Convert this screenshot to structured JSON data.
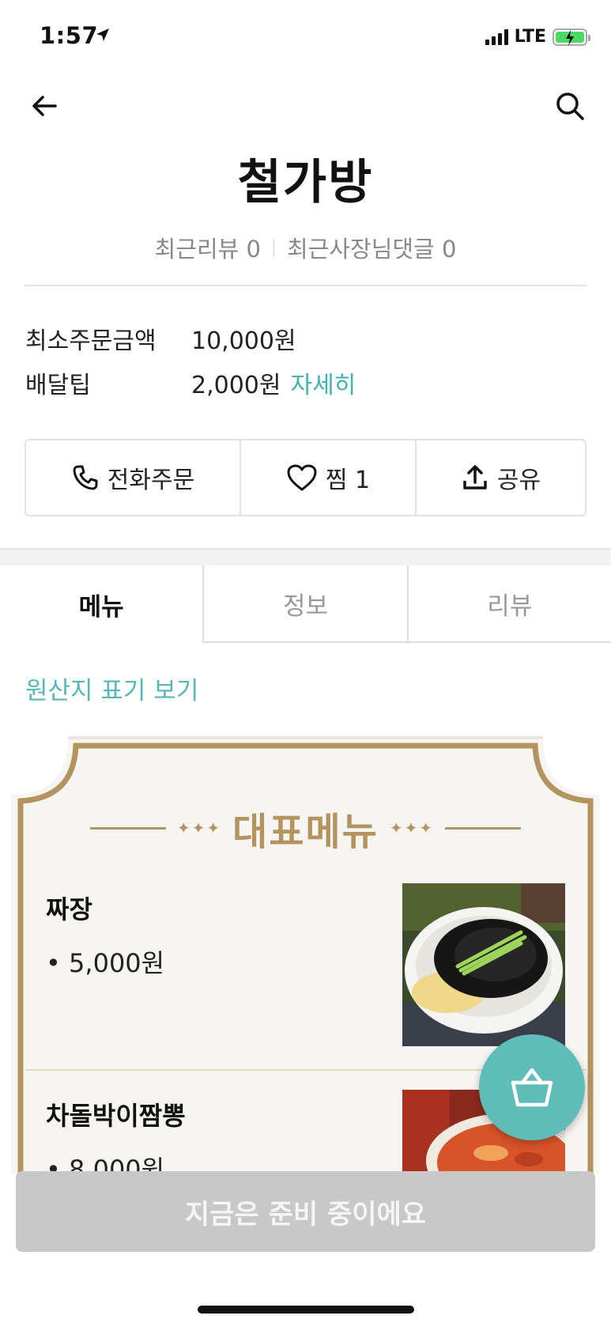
{
  "status_bar": {
    "time": "1:57",
    "network": "LTE"
  },
  "store": {
    "title": "철가방",
    "recent_reviews": "최근리뷰 0",
    "recent_owner_comments": "최근사장님댓글 0"
  },
  "info": {
    "min_order_label": "최소주문금액",
    "min_order_value": "10,000원",
    "delivery_tip_label": "배달팁",
    "delivery_tip_value": "2,000원",
    "delivery_tip_link": "자세히"
  },
  "actions": {
    "phone_order": "전화주문",
    "favorite": "찜 1",
    "share": "공유"
  },
  "tabs": [
    "메뉴",
    "정보",
    "리뷰"
  ],
  "origin_link": "원산지 표기 보기",
  "menu_board": {
    "title": "대표메뉴",
    "items": [
      {
        "name": "짜장",
        "price": "• 5,000원"
      },
      {
        "name": "차돌박이짬뽕",
        "price": "• 8,000원"
      }
    ]
  },
  "cta": "지금은 준비 중이에요",
  "colors": {
    "accent": "#3fb2b2",
    "gold": "#b3935e",
    "fab": "#5fbcb8",
    "cta_disabled": "#c8c8c8"
  }
}
